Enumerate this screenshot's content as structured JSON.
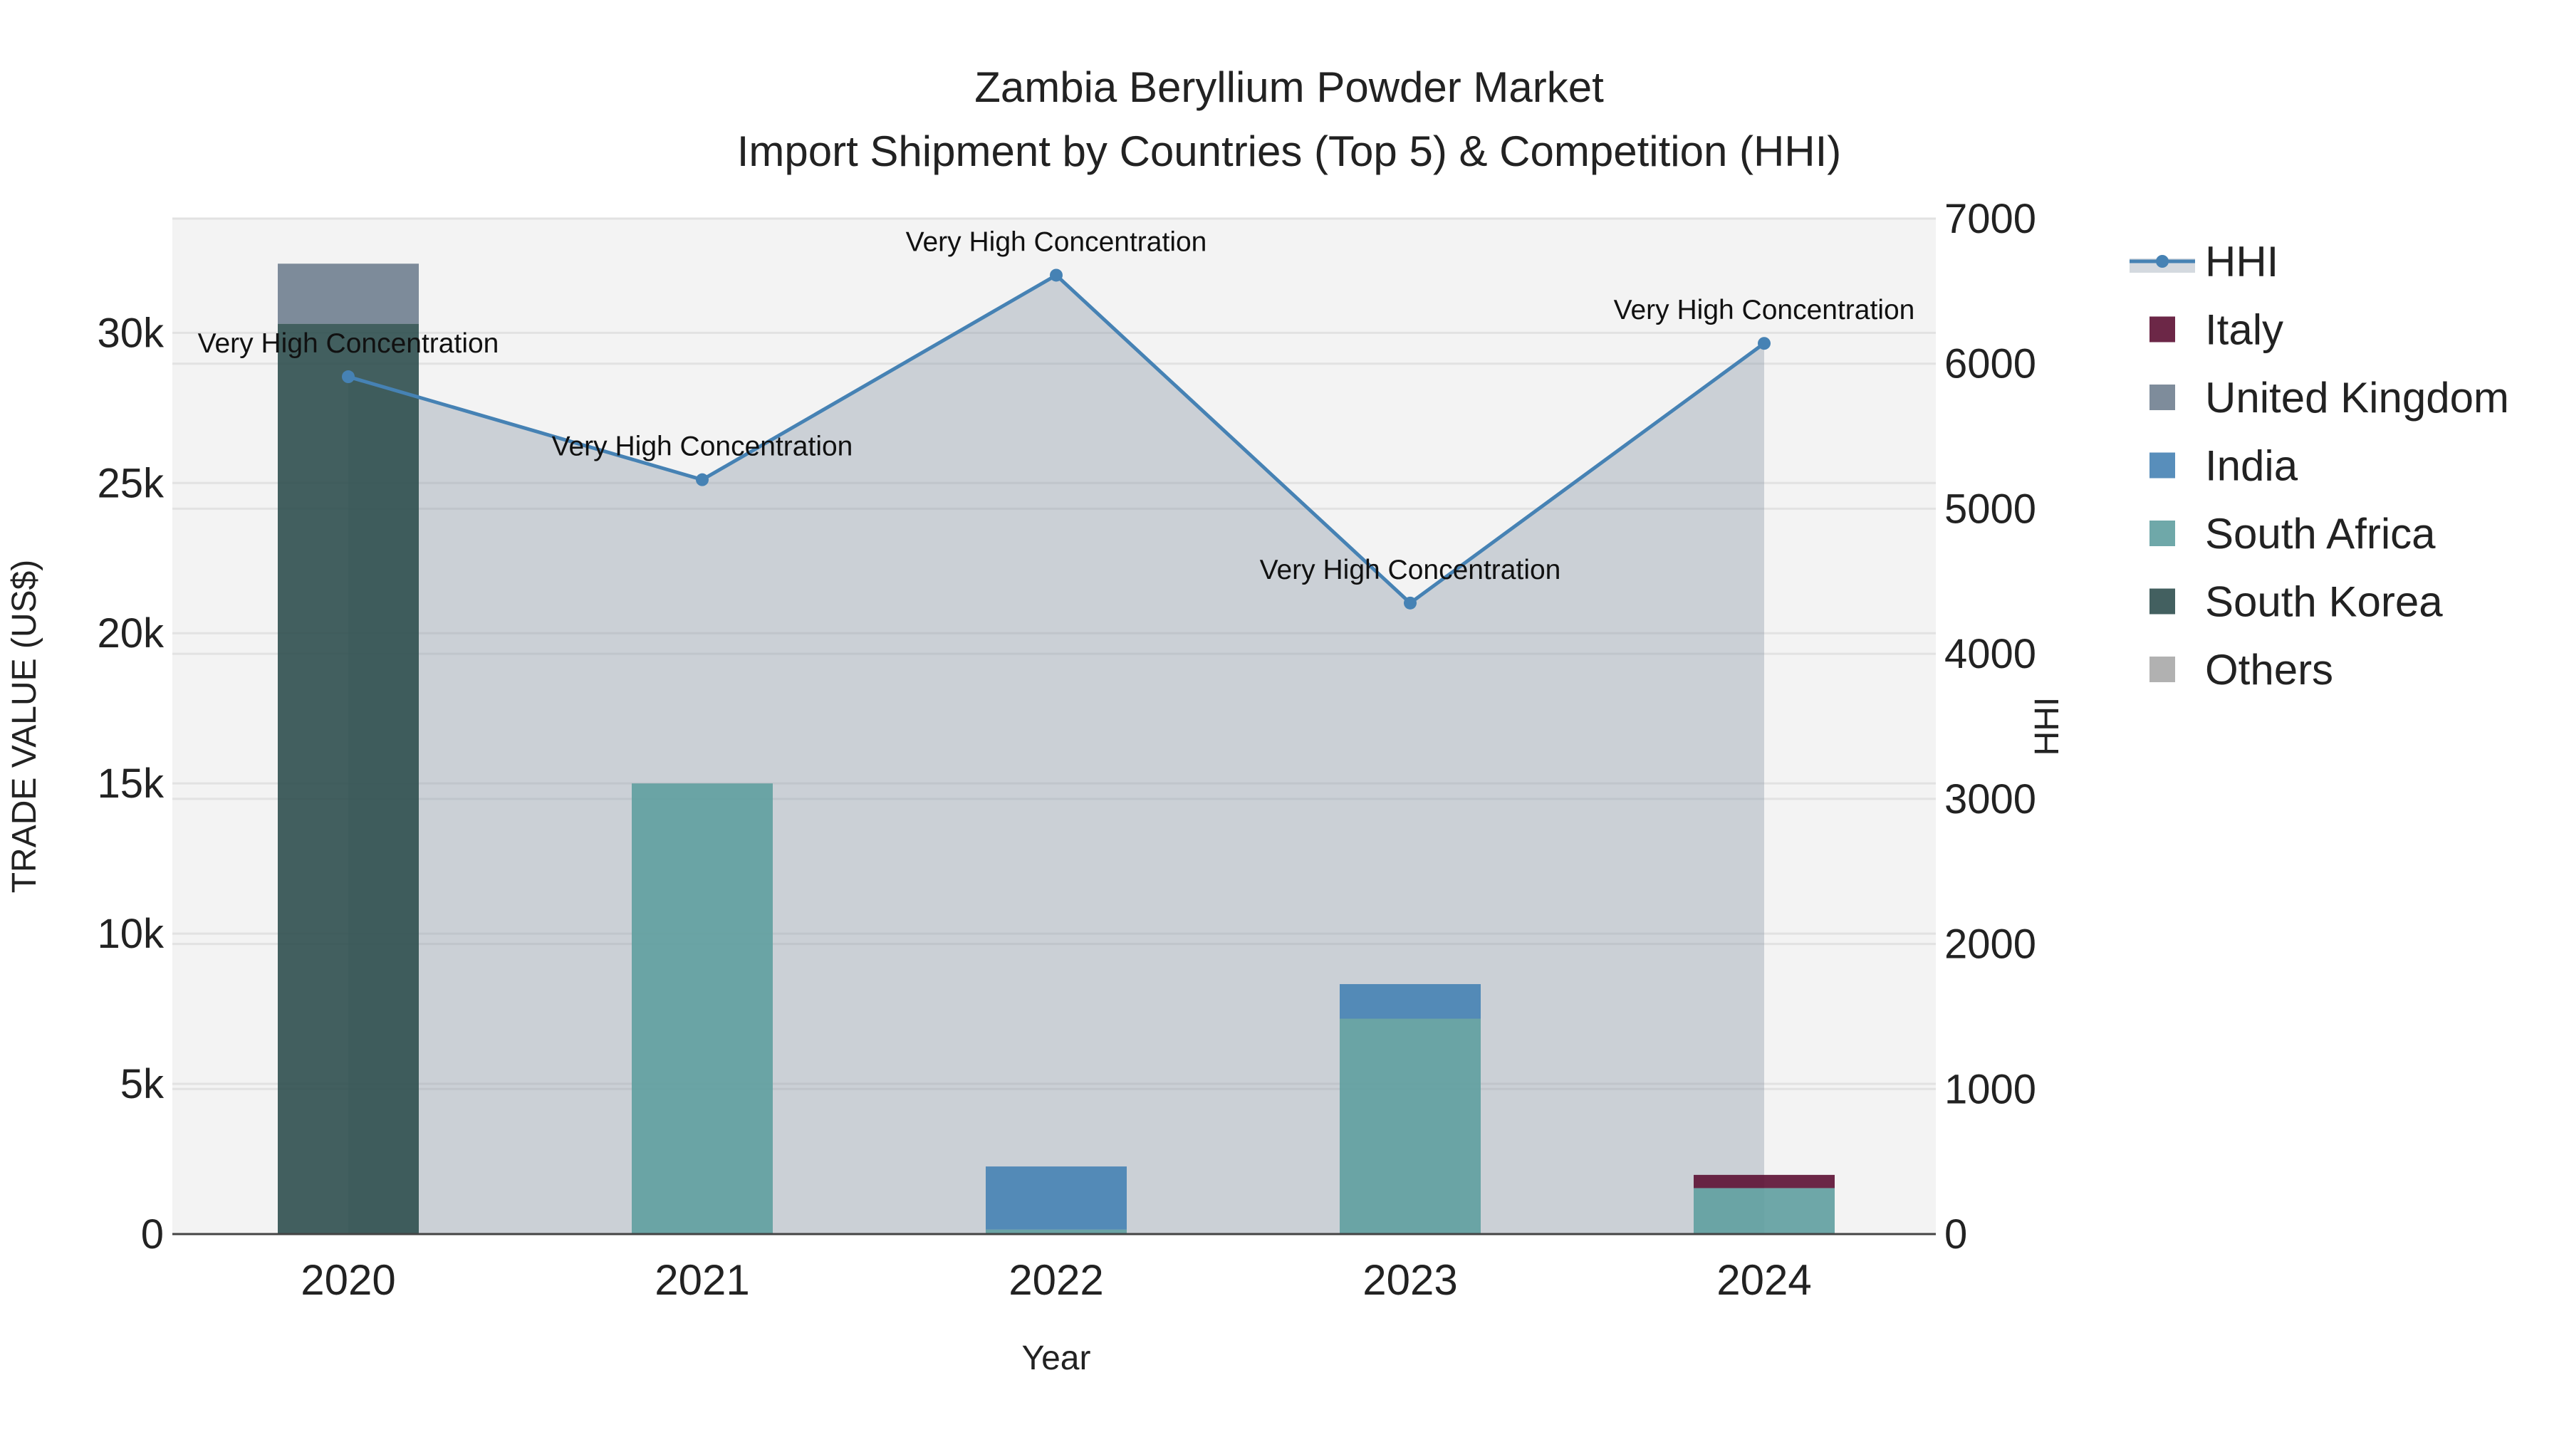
{
  "chart_data": {
    "type": "bar",
    "title": "Zambia Beryllium Powder Market",
    "subtitle": "Import Shipment by Countries (Top 5) & Competition (HHI)",
    "xlabel": "Year",
    "ylabel": "TRADE VALUE (US$)",
    "y2label": "HHI",
    "categories": [
      "2020",
      "2021",
      "2022",
      "2023",
      "2024"
    ],
    "ylim": [
      0,
      33800
    ],
    "y_ticks": [
      0,
      5000,
      10000,
      15000,
      20000,
      25000,
      30000
    ],
    "y_tick_labels": [
      "0",
      "5k",
      "10k",
      "15k",
      "20k",
      "25k",
      "30k"
    ],
    "y2lim": [
      0,
      7000
    ],
    "y2_ticks": [
      0,
      1000,
      2000,
      3000,
      4000,
      5000,
      6000,
      7000
    ],
    "y2_tick_labels": [
      "0",
      "1000",
      "2000",
      "3000",
      "4000",
      "5000",
      "6000",
      "7000"
    ],
    "stacked": true,
    "series": [
      {
        "name": "South Korea",
        "color": "#2f4f4f",
        "values": [
          30300,
          0,
          0,
          0,
          0
        ]
      },
      {
        "name": "South Africa",
        "color": "#5f9ea0",
        "values": [
          0,
          15000,
          150,
          7170,
          1530
        ]
      },
      {
        "name": "India",
        "color": "#4682b4",
        "values": [
          0,
          0,
          2100,
          1150,
          0
        ]
      },
      {
        "name": "United Kingdom",
        "color": "#708090",
        "values": [
          2000,
          0,
          0,
          0,
          0
        ]
      },
      {
        "name": "Italy",
        "color": "#5c0f33",
        "values": [
          0,
          0,
          0,
          0,
          440
        ]
      },
      {
        "name": "Others",
        "color": "#a9a9a9",
        "values": [
          0,
          0,
          0,
          0,
          0
        ]
      }
    ],
    "hhi": {
      "name": "HHI",
      "color": "#4682b4",
      "values": [
        5910,
        5200,
        6610,
        4350,
        6140
      ],
      "annotations": [
        "Very High Concentration",
        "Very High Concentration",
        "Very High Concentration",
        "Very High Concentration",
        "Very High Concentration"
      ]
    },
    "legend": [
      "HHI",
      "Italy",
      "United Kingdom",
      "India",
      "South Africa",
      "South Korea",
      "Others"
    ],
    "legend_placement": "right",
    "grid": true
  }
}
